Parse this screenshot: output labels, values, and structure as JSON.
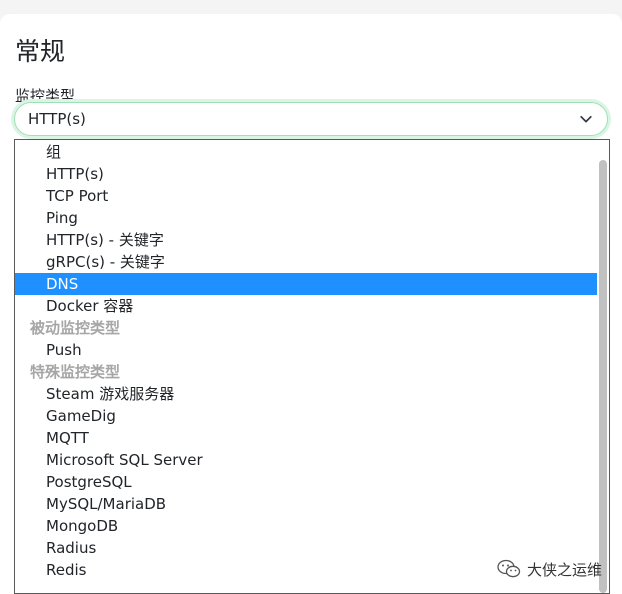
{
  "section": {
    "title": "常规",
    "field_label": "监控类型"
  },
  "select": {
    "value": "HTTP(s)",
    "icon": "chevron-down-icon"
  },
  "dropdown": {
    "items": [
      {
        "kind": "option",
        "label": "组"
      },
      {
        "kind": "option",
        "label": "HTTP(s)"
      },
      {
        "kind": "option",
        "label": "TCP Port"
      },
      {
        "kind": "option",
        "label": "Ping"
      },
      {
        "kind": "option",
        "label": "HTTP(s) - 关键字"
      },
      {
        "kind": "option",
        "label": "gRPC(s) - 关键字"
      },
      {
        "kind": "option",
        "label": "DNS",
        "selected": true
      },
      {
        "kind": "option",
        "label": "Docker 容器"
      },
      {
        "kind": "group",
        "label": "被动监控类型"
      },
      {
        "kind": "option",
        "label": "Push"
      },
      {
        "kind": "group",
        "label": "特殊监控类型"
      },
      {
        "kind": "option",
        "label": "Steam 游戏服务器"
      },
      {
        "kind": "option",
        "label": "GameDig"
      },
      {
        "kind": "option",
        "label": "MQTT"
      },
      {
        "kind": "option",
        "label": "Microsoft SQL Server"
      },
      {
        "kind": "option",
        "label": "PostgreSQL"
      },
      {
        "kind": "option",
        "label": "MySQL/MariaDB"
      },
      {
        "kind": "option",
        "label": "MongoDB"
      },
      {
        "kind": "option",
        "label": "Radius"
      },
      {
        "kind": "option",
        "label": "Redis"
      }
    ]
  },
  "watermark": {
    "text": "大侠之运维",
    "icon": "wechat-icon"
  },
  "colors": {
    "highlight": "#1e90ff",
    "focus_border": "#9fdfb6",
    "group_text": "#a6a6a6"
  }
}
